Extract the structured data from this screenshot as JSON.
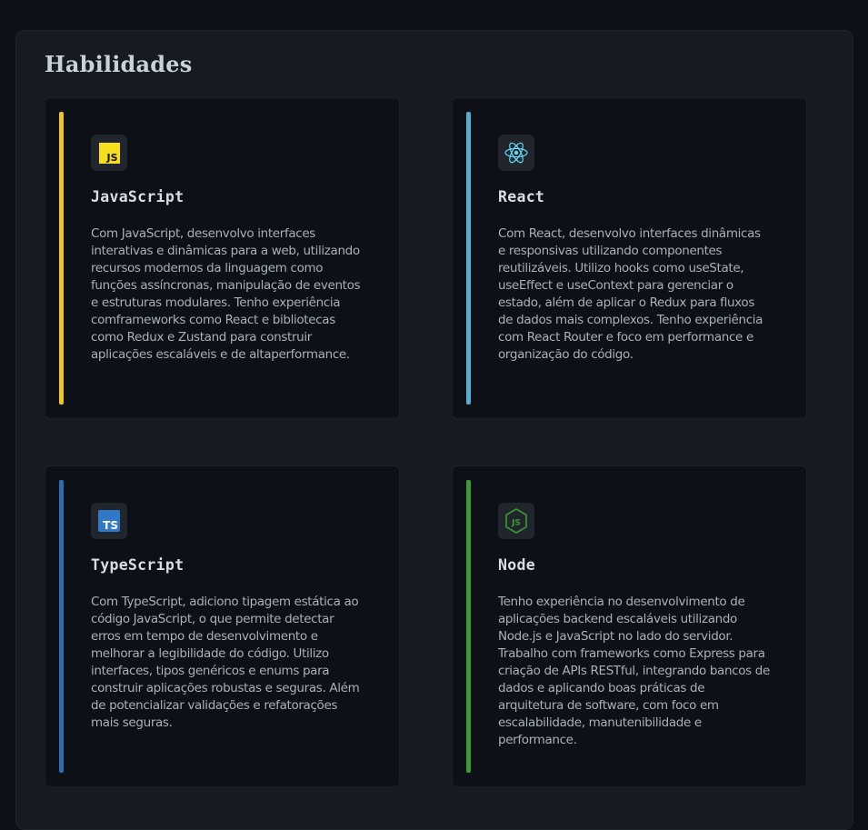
{
  "section": {
    "title": "Habilidades"
  },
  "skills": [
    {
      "name": "JavaScript",
      "icon": "javascript-logo-icon",
      "icon_text": "JS",
      "accent_color": "#f0c61c",
      "description": "Com JavaScript, desenvolvo interfaces interativas e dinâmicas para a web, utilizando recursos modernos da linguagem como funções assíncronas, manipulação de eventos e estruturas modulares. Tenho experiência comframeworks como React e bibliotecas como Redux e Zustand para construir aplicações escaláveis e de altaperformance."
    },
    {
      "name": "React",
      "icon": "react-logo-icon",
      "accent_color": "#4fb1cf",
      "description": "Com React, desenvolvo interfaces dinâmicas e responsivas utilizando componentes reutilizáveis. Utilizo hooks como useState, useEffect e useContext para gerenciar o estado, além de aplicar o Redux para fluxos de dados mais complexos. Tenho experiência com React Router e foco em performance e organização do código."
    },
    {
      "name": "TypeScript",
      "icon": "typescript-logo-icon",
      "icon_text": "TS",
      "accent_color": "#2f6cad",
      "description": "Com TypeScript, adiciono tipagem estática ao código JavaScript, o que permite detectar erros em tempo de desenvolvimento e melhorar a legibilidade do código. Utilizo interfaces, tipos genéricos e enums para construir aplicações robustas e seguras. Além de potencializar validações e refatorações mais seguras."
    },
    {
      "name": "Node",
      "icon": "nodejs-logo-icon",
      "icon_text": "JS",
      "accent_color": "#3d9a35",
      "description": "Tenho experiência no desenvolvimento de aplicações backend escaláveis utilizando Node.js e JavaScript no lado do servidor. Trabalho com frameworks como Express para criação de APIs RESTful, integrando bancos de dados e aplicando boas práticas de arquitetura de software, com foco em escalabilidade, manutenibilidade e performance."
    }
  ],
  "colors": {
    "background": "#0d1117",
    "panel": "#161b22",
    "card": "#0d1117",
    "javascript_yellow": "#f7df1e",
    "typescript_blue": "#3178c6",
    "react_cyan": "#61dafb",
    "node_green": "#3c9a32"
  }
}
